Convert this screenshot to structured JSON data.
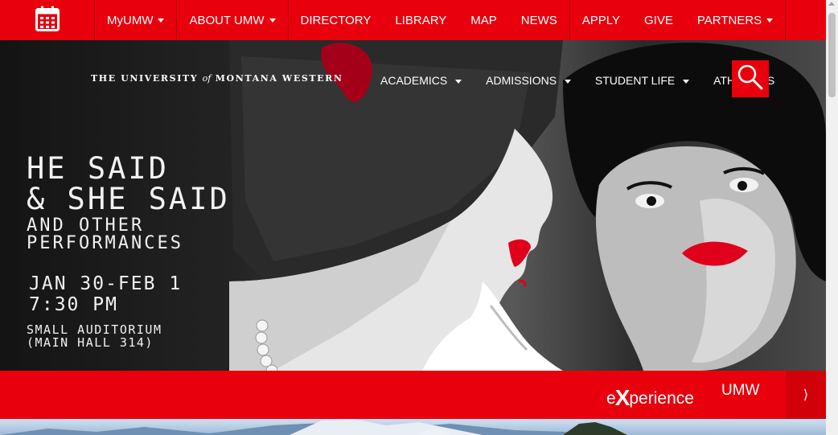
{
  "topbar": {
    "calendar_icon": "calendar-icon",
    "items": [
      {
        "label": "MyUMW",
        "dropdown": true
      },
      {
        "label": "ABOUT UMW",
        "dropdown": true
      },
      {
        "label": "DIRECTORY"
      },
      {
        "label": "LIBRARY"
      },
      {
        "label": "MAP"
      },
      {
        "label": "NEWS"
      },
      {
        "label": "APPLY"
      },
      {
        "label": "GIVE"
      },
      {
        "label": "PARTNERS",
        "dropdown": true
      }
    ]
  },
  "brand": {
    "pre": "THE UNIVERSITY",
    "of": "of",
    "post": "MONTANA WESTERN"
  },
  "mainnav": {
    "items": [
      {
        "label": "ACADEMICS",
        "dropdown": true
      },
      {
        "label": "ADMISSIONS",
        "dropdown": true
      },
      {
        "label": "STUDENT LIFE",
        "dropdown": true
      },
      {
        "label": "ATHLETICS"
      }
    ],
    "search_icon": "search-icon"
  },
  "hero": {
    "title_line1": "HE SAID",
    "title_line2": "& SHE SAID",
    "subtitle_line1": "AND OTHER",
    "subtitle_line2": "PERFORMANCES",
    "date_line1": "JAN 30-FEB 1",
    "date_line2": "7:30 PM",
    "location_line1": "SMALL AUDITORIUM",
    "location_line2": "(MAIN HALL 314)"
  },
  "experience_bar": {
    "logo_pre": "e",
    "logo_x": "X",
    "logo_post": "perience",
    "label": "UMW",
    "next_glyph": "⟩"
  },
  "colors": {
    "brand_red": "#e8000d",
    "hero_dark": "#1a1a1a",
    "lip_red": "#e0001b"
  }
}
